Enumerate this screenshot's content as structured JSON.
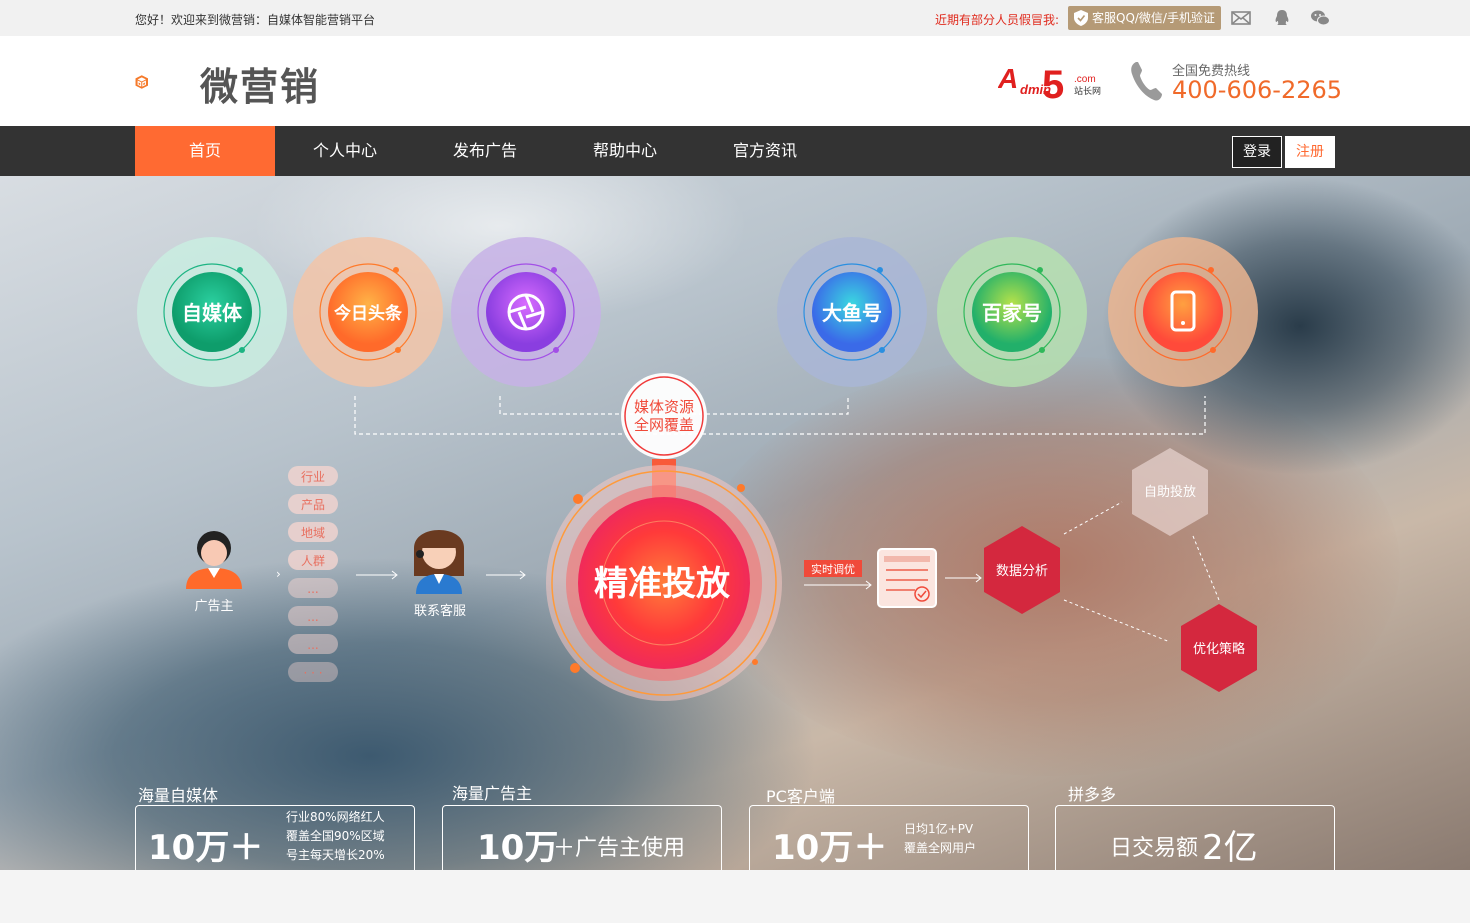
{
  "topbar": {
    "welcome": "您好！欢迎来到微营销：自媒体智能营销平台",
    "warning": "近期有部分人员假冒我:",
    "verify_label": "客服QQ/微信/手机验证"
  },
  "header": {
    "logo_text": "微营销",
    "partner_logo": "A5站长网",
    "partner_com": ".com",
    "partner_name": "站长网",
    "hotline_label": "全国免费热线",
    "hotline_number": "400-606-2265"
  },
  "nav": {
    "items": [
      {
        "label": "首页",
        "active": true
      },
      {
        "label": "个人中心"
      },
      {
        "label": "发布广告"
      },
      {
        "label": "帮助中心"
      },
      {
        "label": "官方资讯"
      }
    ],
    "login": "登录",
    "register": "注册"
  },
  "hero": {
    "platforms": [
      {
        "label": "自媒体",
        "color": "#1db483"
      },
      {
        "label": "今日头条",
        "color": "#ff7a2a"
      },
      {
        "label": "camera-icon",
        "color": "#a24fe6"
      },
      {
        "label": "大鱼号",
        "color": "#2a8fe0"
      },
      {
        "label": "百家号",
        "color": "#2fb85a"
      },
      {
        "label": "phone-icon",
        "color": "#ff6a2a"
      }
    ],
    "hub_label_1": "媒体资源",
    "hub_label_2": "全网覆盖",
    "center_label": "精准投放",
    "realtime_label": "实时调优",
    "advertiser_label": "广告主",
    "service_label": "联系客服",
    "tags": [
      "行业",
      "产品",
      "地域",
      "人群",
      "...",
      "...",
      "...",
      "· · ·"
    ],
    "hex": [
      {
        "label": "数据分析"
      },
      {
        "label": "自助投放"
      },
      {
        "label": "优化策略"
      }
    ]
  },
  "stats": [
    {
      "label": "海量自媒体",
      "big": "10万＋",
      "lines": [
        "行业80%网络红人",
        "覆盖全国90%区域",
        "号主每天增长20%"
      ]
    },
    {
      "label": "海量广告主",
      "big": "10万",
      "suffix": "＋广告主使用"
    },
    {
      "label": "PC客户端",
      "big": "10万＋",
      "lines": [
        "日均1亿+PV",
        "覆盖全网用户"
      ]
    },
    {
      "label": "拼多多",
      "prefix": "日交易额",
      "big": "2亿"
    }
  ]
}
